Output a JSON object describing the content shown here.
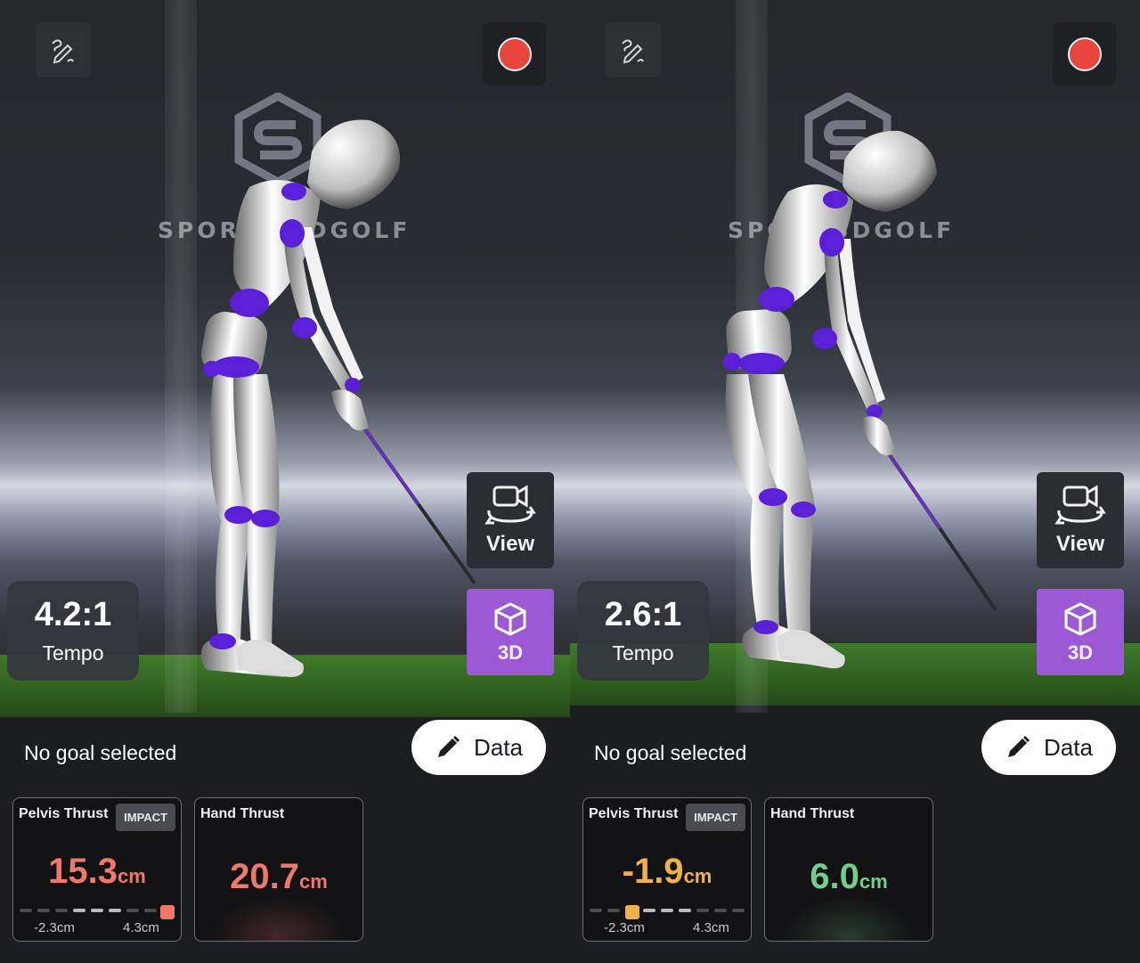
{
  "left": {
    "watermark": "SPORTS      3DGOLF",
    "view_label": "View",
    "three_d_label": "3D",
    "tempo": {
      "value": "4.2:1",
      "label": "Tempo"
    },
    "goal_text": "No goal selected",
    "data_button": "Data",
    "pelvis_card": {
      "title": "Pelvis Thrust",
      "tag": "IMPACT",
      "value": "15.3",
      "unit": "cm",
      "min_label": "-2.3cm",
      "max_label": "4.3cm",
      "color": "#f0786a"
    },
    "hand_card": {
      "title": "Hand Thrust",
      "value": "20.7",
      "unit": "cm",
      "color": "#f0786a"
    }
  },
  "right": {
    "watermark": "SPO           X 3DGOLF",
    "view_label": "View",
    "three_d_label": "3D",
    "tempo": {
      "value": "2.6:1",
      "label": "Tempo"
    },
    "goal_text": "No goal selected",
    "data_button": "Data",
    "pelvis_card": {
      "title": "Pelvis Thrust",
      "tag": "IMPACT",
      "value": "-1.9",
      "unit": "cm",
      "min_label": "-2.3cm",
      "max_label": "4.3cm",
      "color": "#f1b14a"
    },
    "hand_card": {
      "title": "Hand Thrust",
      "value": "6.0",
      "unit": "cm",
      "color": "#6fd08a"
    }
  },
  "icons": {
    "draw": "pencil-scribble-icon",
    "record": "record-icon",
    "view": "camera-rotate-icon",
    "three_d": "cube-icon",
    "edit": "pencil-icon"
  },
  "colors": {
    "accent_purple": "#9b59d6",
    "record_red": "#e8463d",
    "bad": "#f0786a",
    "warn": "#f1b14a",
    "good": "#6fd08a"
  }
}
